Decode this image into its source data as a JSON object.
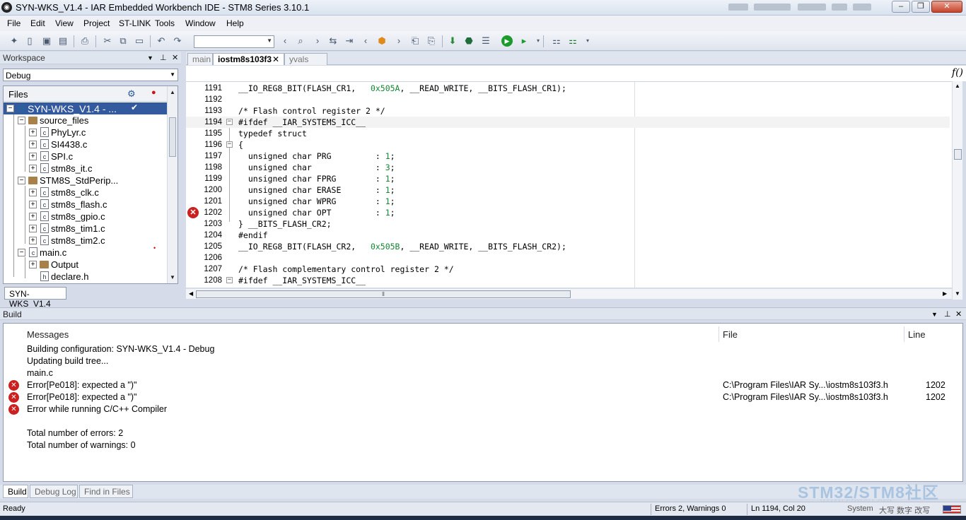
{
  "window": {
    "title": "SYN-WKS_V1.4 - IAR Embedded Workbench IDE - STM8 Series 3.10.1",
    "app_icon": "iar-logo-icon"
  },
  "menu": [
    "File",
    "Edit",
    "View",
    "Project",
    "ST-LINK",
    "Tools",
    "Window",
    "Help"
  ],
  "workspace": {
    "title": "Workspace",
    "configuration": "Debug",
    "files_header": "Files",
    "tree": [
      {
        "label": "SYN-WKS_V1.4 - ...",
        "depth": 0,
        "type": "project",
        "selected": true,
        "checked": true
      },
      {
        "label": "source_files",
        "depth": 1,
        "type": "folder"
      },
      {
        "label": "PhyLyr.c",
        "depth": 2,
        "type": "file"
      },
      {
        "label": "SI4438.c",
        "depth": 2,
        "type": "file"
      },
      {
        "label": "SPI.c",
        "depth": 2,
        "type": "file"
      },
      {
        "label": "stm8s_it.c",
        "depth": 2,
        "type": "file"
      },
      {
        "label": "STM8S_StdPerip...",
        "depth": 1,
        "type": "folder"
      },
      {
        "label": "stm8s_clk.c",
        "depth": 2,
        "type": "file"
      },
      {
        "label": "stm8s_flash.c",
        "depth": 2,
        "type": "file"
      },
      {
        "label": "stm8s_gpio.c",
        "depth": 2,
        "type": "file"
      },
      {
        "label": "stm8s_tim1.c",
        "depth": 2,
        "type": "file"
      },
      {
        "label": "stm8s_tim2.c",
        "depth": 2,
        "type": "file"
      },
      {
        "label": "main.c",
        "depth": 1,
        "type": "file",
        "error_dot": true
      },
      {
        "label": "Output",
        "depth": 2,
        "type": "folder"
      },
      {
        "label": "declare.h",
        "depth": 2,
        "type": "file"
      }
    ],
    "bottom_tab": "SYN-WKS_V1.4"
  },
  "editor": {
    "tabs": [
      {
        "label": "main",
        "active": false
      },
      {
        "label": "iostm8s103f3",
        "active": true,
        "closable": true
      },
      {
        "label": "yvals [RO]",
        "active": false
      }
    ],
    "function_icon": "f()",
    "lines": [
      {
        "n": "1191",
        "code": "__IO_REG8_BIT(FLASH_CR1,   0x505A, __READ_WRITE, __BITS_FLASH_CR1);"
      },
      {
        "n": "1192",
        "code": ""
      },
      {
        "n": "1193",
        "code": "/* Flash control register 2 */"
      },
      {
        "n": "1194",
        "code": "#ifdef __IAR_SYSTEMS_ICC__"
      },
      {
        "n": "1195",
        "code": "typedef struct"
      },
      {
        "n": "1196",
        "code": "{"
      },
      {
        "n": "1197",
        "code": "  unsigned char PRG         : 1;"
      },
      {
        "n": "1198",
        "code": "  unsigned char             : 3;"
      },
      {
        "n": "1199",
        "code": "  unsigned char FPRG        : 1;"
      },
      {
        "n": "1200",
        "code": "  unsigned char ERASE       : 1;"
      },
      {
        "n": "1201",
        "code": "  unsigned char WPRG        : 1;"
      },
      {
        "n": "1202",
        "code": "  unsigned char OPT         : 1;"
      },
      {
        "n": "1203",
        "code": "} __BITS_FLASH_CR2;"
      },
      {
        "n": "1204",
        "code": "#endif"
      },
      {
        "n": "1205",
        "code": "__IO_REG8_BIT(FLASH_CR2,   0x505B, __READ_WRITE, __BITS_FLASH_CR2);"
      },
      {
        "n": "1206",
        "code": ""
      },
      {
        "n": "1207",
        "code": "/* Flash complementary control register 2 */"
      },
      {
        "n": "1208",
        "code": "#ifdef __IAR_SYSTEMS_ICC__"
      }
    ]
  },
  "build": {
    "title": "Build",
    "columns": {
      "messages": "Messages",
      "file": "File",
      "line": "Line"
    },
    "rows": [
      {
        "msg": "Building configuration: SYN-WKS_V1.4 - Debug",
        "file": "",
        "line": "",
        "error": false
      },
      {
        "msg": "Updating build tree...",
        "file": "",
        "line": "",
        "error": false
      },
      {
        "msg": "main.c",
        "file": "",
        "line": "",
        "error": false
      },
      {
        "msg": "Error[Pe018]: expected a \")\"",
        "file": "C:\\Program Files\\IAR Sy...\\iostm8s103f3.h",
        "line": "1202",
        "error": true
      },
      {
        "msg": "Error[Pe018]: expected a \")\"",
        "file": "C:\\Program Files\\IAR Sy...\\iostm8s103f3.h",
        "line": "1202",
        "error": true
      },
      {
        "msg": "Error while running C/C++ Compiler",
        "file": "",
        "line": "",
        "error": true
      },
      {
        "msg": "",
        "file": "",
        "line": "",
        "error": false
      },
      {
        "msg": "Total number of errors: 2",
        "file": "",
        "line": "",
        "error": false
      },
      {
        "msg": "Total number of warnings: 0",
        "file": "",
        "line": "",
        "error": false
      }
    ],
    "tabs": [
      "Build",
      "Debug Log",
      "Find in Files"
    ],
    "watermark": "STM32/STM8社区",
    "watermark_url": "www.stmcu.org"
  },
  "status": {
    "ready": "Ready",
    "errors": "Errors 2, Warnings 0",
    "position": "Ln 1194, Col 20",
    "system": "System",
    "ime": "大写 数字 改写"
  },
  "colors": {
    "selection": "#33599e",
    "error": "#cc1f1f",
    "comment": "#1a3db3",
    "number": "#118833"
  }
}
